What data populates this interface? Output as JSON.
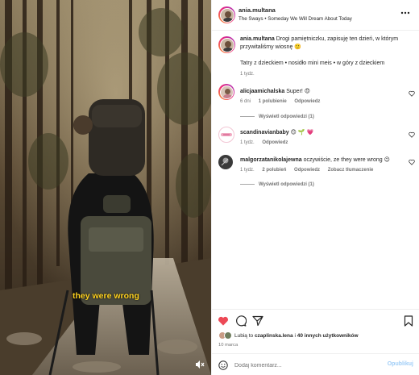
{
  "media": {
    "caption_text": "they were wrong",
    "mute_icon": "mute-icon"
  },
  "header": {
    "username": "ania.multana",
    "audio": "The Sways • Someday We Will Dream About Today",
    "more_icon": "more-icon"
  },
  "post_caption": {
    "username": "ania.multana",
    "text": "Drogi pamiętniczku, zapisuję ten dzień, w którym przywitaliśmy wiosnę 🙂",
    "tags": "Tatry z dzieckiem • nosidło mini meis • w góry z dzieckiem",
    "time": "1 tydz."
  },
  "comments": [
    {
      "username": "alicjaamichalska",
      "text": "Super! 😍",
      "time": "6 dni",
      "likes": "1 polubienie",
      "reply": "Odpowiedz",
      "view_replies": "Wyświetl odpowiedzi (1)"
    },
    {
      "username": "scandinavianbaby",
      "text": "😊 🌱 💗",
      "time": "1 tydz.",
      "reply": "Odpowiedz"
    },
    {
      "username": "malgorzatanikolajewna",
      "text": "oczywiście, ze they were wrong 😉",
      "time": "1 tydz.",
      "likes": "2 polubień",
      "reply": "Odpowiedz",
      "translate": "Zobacz tłumaczenie",
      "view_replies": "Wyświetl odpowiedzi (1)"
    }
  ],
  "actions": {
    "like_icon": "heart-filled-icon",
    "comment_icon": "comment-icon",
    "share_icon": "share-icon",
    "save_icon": "bookmark-icon",
    "likes_prefix": "Lubią to ",
    "likes_user": "czaplinska.lena",
    "likes_mid": " i ",
    "likes_others": "40 innych użytkowników",
    "date": "10 marca"
  },
  "add_comment": {
    "placeholder": "Dodaj komentarz...",
    "post_label": "Opublikuj",
    "emoji_icon": "smiley-icon"
  },
  "colors": {
    "like_red": "#ed4956",
    "caption_yellow": "#ffd21f",
    "post_blue_disabled": "#9fcdf7"
  }
}
